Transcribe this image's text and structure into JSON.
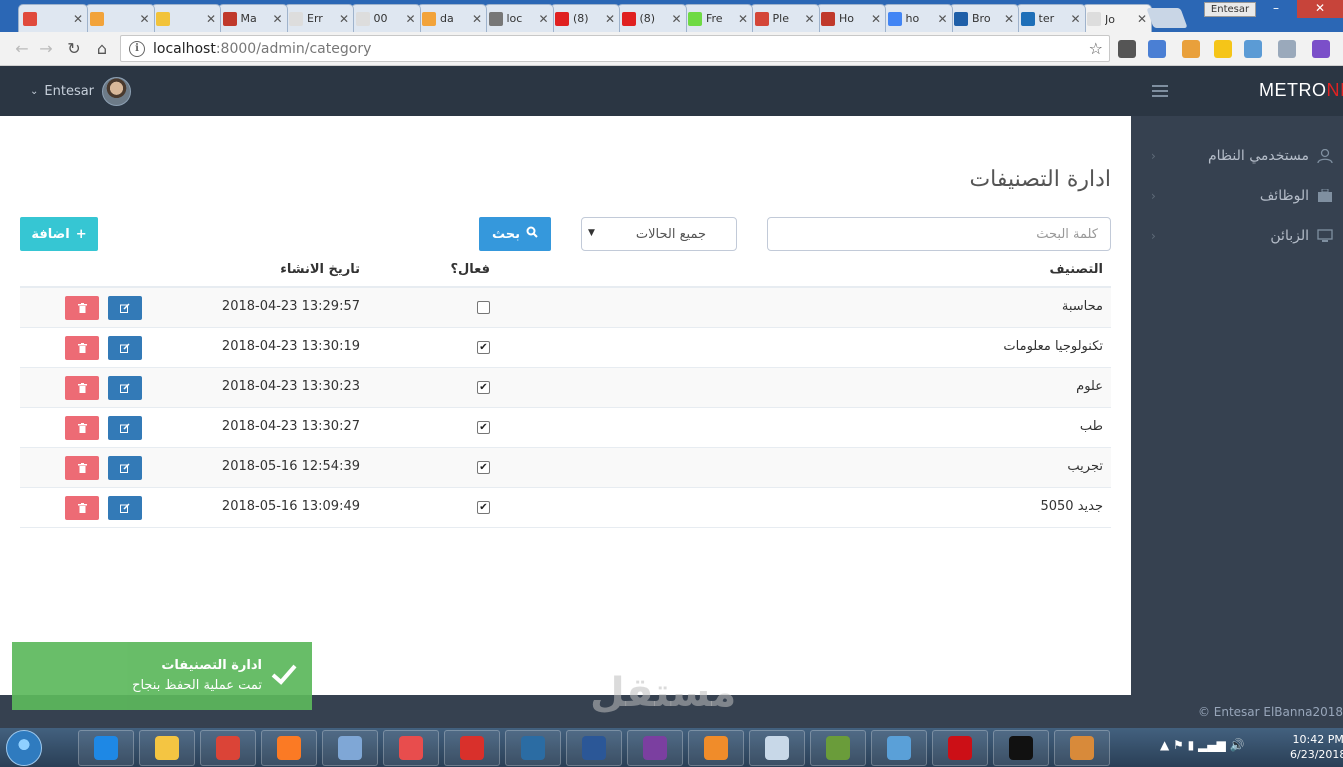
{
  "browser": {
    "tabs": [
      {
        "label": "",
        "color": "#e04a3c"
      },
      {
        "label": "",
        "color": "#f2a33a"
      },
      {
        "label": "",
        "color": "#f2c33a"
      },
      {
        "label": "Ma",
        "color": "#c0392b"
      },
      {
        "label": "Err",
        "color": "#dddddd"
      },
      {
        "label": "00",
        "color": "#dddddd"
      },
      {
        "label": "da",
        "color": "#f2a33a"
      },
      {
        "label": "loc",
        "color": "#777777"
      },
      {
        "label": "(8)",
        "color": "#e02020"
      },
      {
        "label": "(8)",
        "color": "#e02020"
      },
      {
        "label": "Fre",
        "color": "#6fda44"
      },
      {
        "label": "Ple",
        "color": "#d44638"
      },
      {
        "label": "Ho",
        "color": "#c0392b"
      },
      {
        "label": "ho",
        "color": "#4285f4"
      },
      {
        "label": "Bro",
        "color": "#1f5fa8"
      },
      {
        "label": "ter",
        "color": "#1e6fb8"
      },
      {
        "label": "Jo",
        "color": "#dddddd"
      }
    ],
    "profile": "Entesar",
    "url_host": "localhost",
    "url_path": ":8000/admin/category"
  },
  "header": {
    "user_name": "Entesar",
    "logo_main": "METRO",
    "logo_accent": "NIC"
  },
  "sidebar": {
    "items": [
      {
        "label": "مستخدمي النظام",
        "icon": "user-icon"
      },
      {
        "label": "الوظائف",
        "icon": "briefcase-icon"
      },
      {
        "label": "الزبائن",
        "icon": "monitor-icon"
      }
    ]
  },
  "page": {
    "title": "ادارة التصنيفات",
    "search_placeholder": "كلمة البحث",
    "status_select": "جميع الحالات",
    "search_button": "بحث",
    "add_button": "اضافة"
  },
  "table": {
    "headers": {
      "name": "التصنيف",
      "active": "فعال؟",
      "created": "تاريخ الانشاء"
    },
    "rows": [
      {
        "name": "محاسبة",
        "active": false,
        "created": "2018-04-23 13:29:57"
      },
      {
        "name": "تكنولوجيا معلومات",
        "active": true,
        "created": "2018-04-23 13:30:19"
      },
      {
        "name": "علوم",
        "active": true,
        "created": "2018-04-23 13:30:23"
      },
      {
        "name": "طب",
        "active": true,
        "created": "2018-04-23 13:30:27"
      },
      {
        "name": "تجريب",
        "active": true,
        "created": "2018-05-16 12:54:39"
      },
      {
        "name": "جديد 5050",
        "active": true,
        "created": "2018-05-16 13:09:49"
      }
    ]
  },
  "toast": {
    "title": "ادارة التصنيفات",
    "message": "تمت عملية الحفظ بنجاح"
  },
  "footer": {
    "copyright": "© Entesar ElBanna2018"
  },
  "watermark": "مستقل",
  "taskbar": {
    "time": "10:42 PM",
    "date": "6/23/2018",
    "apps": [
      {
        "name": "ie",
        "color": "#1e88e5"
      },
      {
        "name": "explorer",
        "color": "#f4c542"
      },
      {
        "name": "chrome",
        "color": "#db4437"
      },
      {
        "name": "xampp",
        "color": "#fb7a24"
      },
      {
        "name": "jc",
        "color": "#7fa7d6"
      },
      {
        "name": "app6",
        "color": "#e84d4d"
      },
      {
        "name": "pdf",
        "color": "#d9302b"
      },
      {
        "name": "app8",
        "color": "#2b6ca3"
      },
      {
        "name": "word",
        "color": "#2b5797"
      },
      {
        "name": "media",
        "color": "#7b3fa0"
      },
      {
        "name": "app11",
        "color": "#f08c2a"
      },
      {
        "name": "app12",
        "color": "#c8d8e8"
      },
      {
        "name": "app13",
        "color": "#6a9c3a"
      },
      {
        "name": "app14",
        "color": "#5aa0d8"
      },
      {
        "name": "opera",
        "color": "#cc0f16"
      },
      {
        "name": "cmd",
        "color": "#111111"
      },
      {
        "name": "app17",
        "color": "#d88a3a"
      }
    ]
  }
}
